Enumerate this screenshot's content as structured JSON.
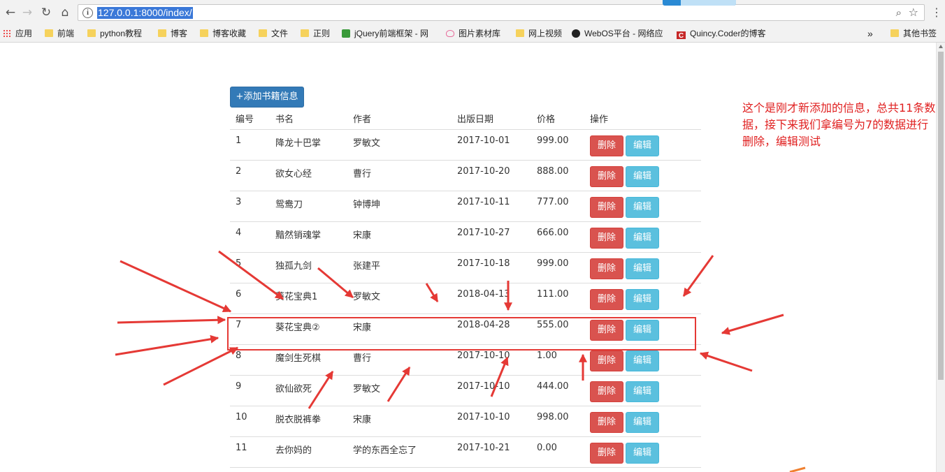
{
  "browser": {
    "url": "127.0.0.1:8000/index/",
    "bookmarks": [
      {
        "label": "应用",
        "icon": "apps-grid-icon"
      },
      {
        "label": "前端",
        "icon": "folder-icon"
      },
      {
        "label": "python教程",
        "icon": "folder-icon"
      },
      {
        "label": "博客",
        "icon": "folder-icon"
      },
      {
        "label": "博客收藏",
        "icon": "folder-icon"
      },
      {
        "label": "文件",
        "icon": "folder-icon"
      },
      {
        "label": "正则",
        "icon": "folder-icon"
      },
      {
        "label": "jQuery前端框架 - 网",
        "icon": "jquery-icon"
      },
      {
        "label": "图片素材库",
        "icon": "heart-icon"
      },
      {
        "label": "网上视频",
        "icon": "folder-icon"
      },
      {
        "label": "WebOS平台 - 网络应",
        "icon": "webos-icon"
      },
      {
        "label": "Quincy.Coder的博客",
        "icon": "c-logo-icon"
      }
    ],
    "overflow_label": "»",
    "other_bookmarks": "其他书签"
  },
  "page": {
    "add_button": "+添加书籍信息",
    "headers": [
      "编号",
      "书名",
      "作者",
      "出版日期",
      "价格",
      "操作"
    ],
    "delete_label": "删除",
    "edit_label": "编辑",
    "rows": [
      {
        "id": "1",
        "title": "降龙十巴掌",
        "author": "罗敏文",
        "date": "2017-10-01",
        "price": "999.00"
      },
      {
        "id": "2",
        "title": "欲女心经",
        "author": "曹行",
        "date": "2017-10-20",
        "price": "888.00"
      },
      {
        "id": "3",
        "title": "鸳鸯刀",
        "author": "钟博坤",
        "date": "2017-10-11",
        "price": "777.00"
      },
      {
        "id": "4",
        "title": "黯然销魂掌",
        "author": "宋康",
        "date": "2017-10-27",
        "price": "666.00"
      },
      {
        "id": "5",
        "title": "独孤九剑",
        "author": "张建平",
        "date": "2017-10-18",
        "price": "999.00"
      },
      {
        "id": "6",
        "title": "葵花宝典1",
        "author": "罗敏文",
        "date": "2018-04-13",
        "price": "111.00"
      },
      {
        "id": "7",
        "title": "葵花宝典②",
        "author": "宋康",
        "date": "2018-04-28",
        "price": "555.00"
      },
      {
        "id": "8",
        "title": "魔剑生死棋",
        "author": "曹行",
        "date": "2017-10-10",
        "price": "1.00"
      },
      {
        "id": "9",
        "title": "欲仙欲死",
        "author": "罗敏文",
        "date": "2017-10-10",
        "price": "444.00"
      },
      {
        "id": "10",
        "title": "脱衣脱裤拳",
        "author": "宋康",
        "date": "2017-10-10",
        "price": "998.00"
      },
      {
        "id": "11",
        "title": "去你妈的",
        "author": "学的东西全忘了",
        "date": "2017-10-21",
        "price": "0.00"
      }
    ],
    "annotation": "这个是刚才新添加的信息，总共11条数据，接下来我们拿编号为7的数据进行删除，编辑测试"
  },
  "colors": {
    "primary": "#337ab7",
    "danger": "#d9534f",
    "info": "#5bc0de",
    "annotation_red": "#e53935"
  }
}
